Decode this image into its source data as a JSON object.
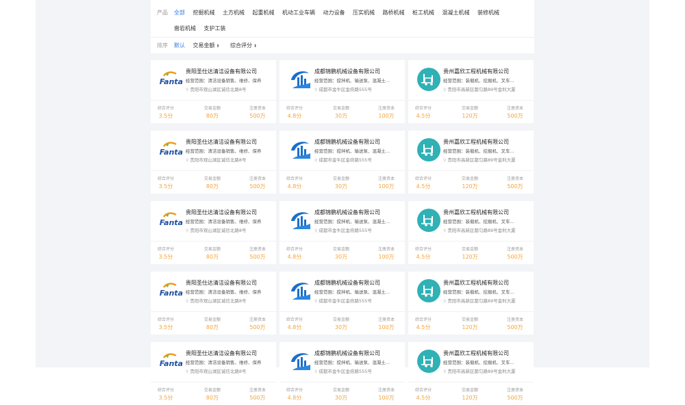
{
  "filters": {
    "product_label": "产品",
    "categories": [
      "全部",
      "挖掘机械",
      "土方机械",
      "起重机械",
      "机动工业车辆",
      "动力设备",
      "压实机械",
      "路桥机械",
      "桩工机械",
      "混凝土机械",
      "装修机械"
    ],
    "categories_row2": [
      "凿岩机械",
      "支护工装"
    ],
    "sort_label": "排序",
    "sort_options": [
      "默认",
      "交易金额",
      "综合评分"
    ]
  },
  "stat_labels": {
    "rating": "综合评分",
    "amount": "交易金额",
    "capital": "注册资本"
  },
  "templates": [
    {
      "logo": "fanta-logo",
      "name": "贵阳圣仕达清洁设备有限公司",
      "scope": "经营范围：清洁设备销售、维修、保养",
      "address": "贵阳市观山湖区诚信北路8号",
      "rating": "3.5分",
      "amount": "80万",
      "capital": "500万"
    },
    {
      "logo": "building-logo",
      "name": "成都锦鹏机械设备有限公司",
      "scope": "经营范围：搅拌机、输送泵、混凝土...",
      "address": "成都市金牛区金府路555号",
      "rating": "4.8分",
      "amount": "30万",
      "capital": "100万"
    },
    {
      "logo": "forklift-logo",
      "name": "贵州嘉欣工程机械有限公司",
      "scope": "经营范围：装载机、挖掘机、叉车...",
      "address": "贵阳市高新区都匀路89号金利大厦",
      "rating": "4.5分",
      "amount": "120万",
      "capital": "500万"
    }
  ],
  "rows": 5,
  "colors": {
    "accent": "#2f7ae5",
    "value": "#f4a43b",
    "teal": "#2fb1b5",
    "blue": "#1b6fc9",
    "fanta_blue": "#1d4ea3"
  }
}
